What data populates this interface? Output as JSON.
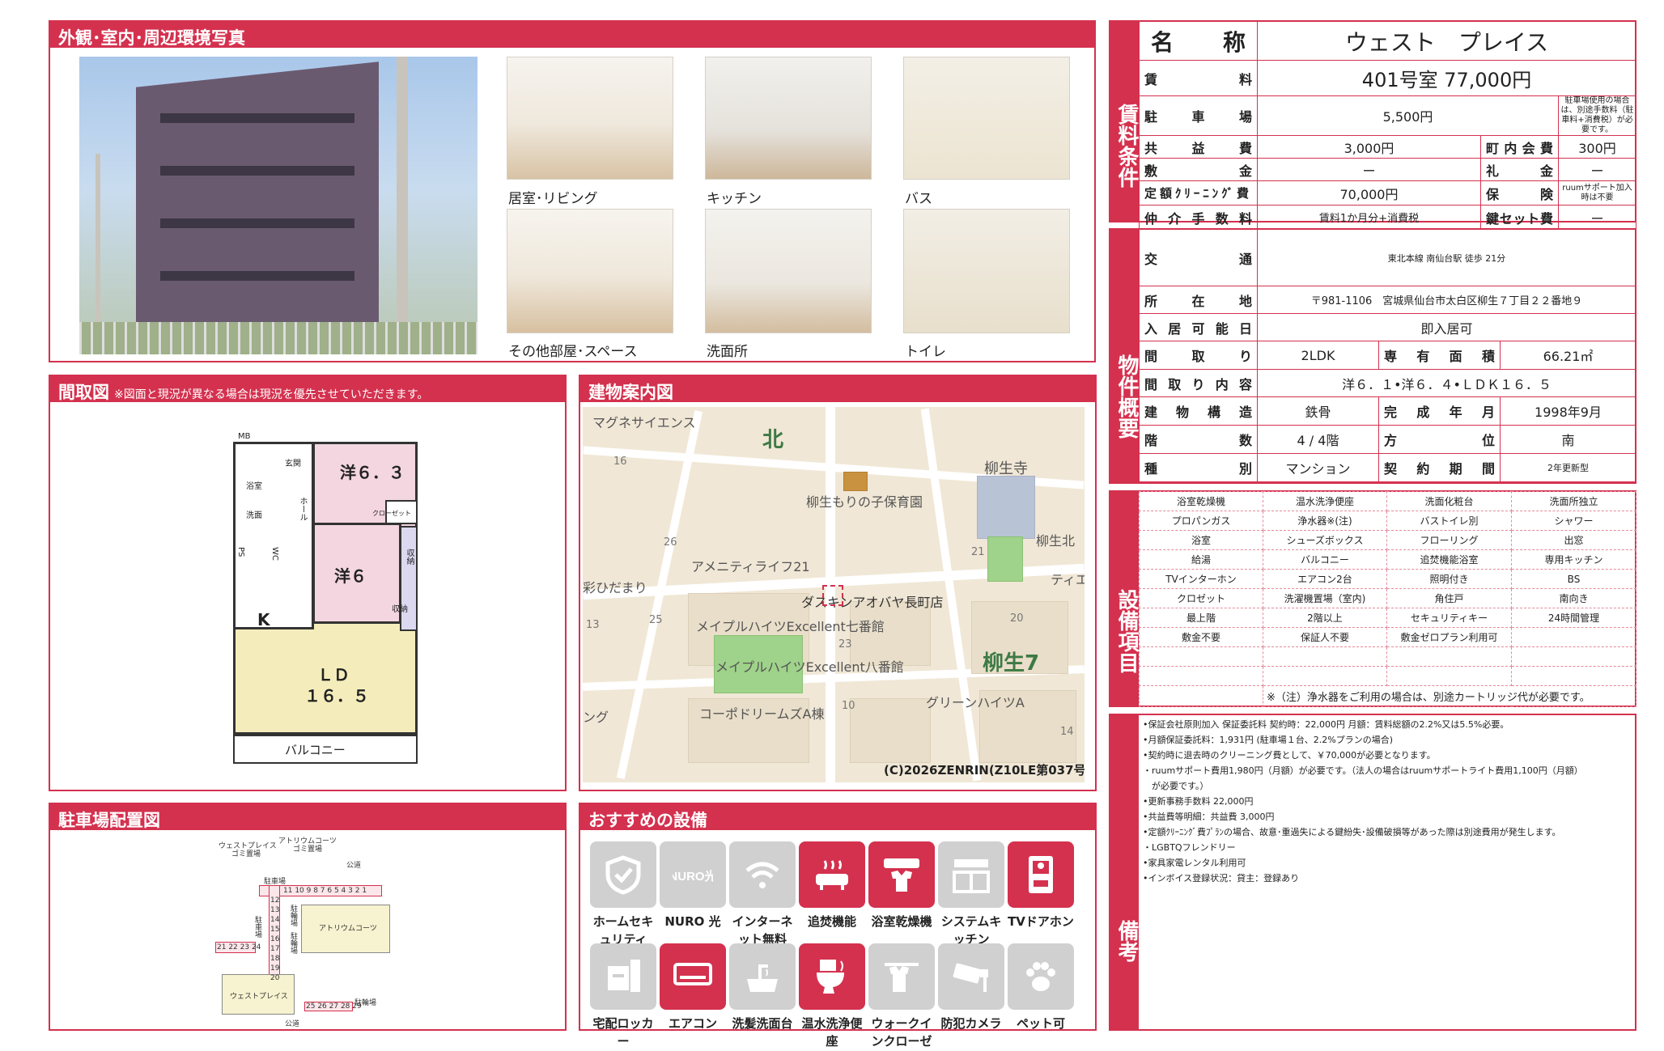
{
  "photos_section": {
    "title": "外観･室内･周辺環境写真",
    "labels": [
      "居室･リビング",
      "キッチン",
      "バス",
      "その他部屋･スペース",
      "洗面所",
      "トイレ"
    ]
  },
  "floorplan": {
    "title": "間取図",
    "note": "※図面と現況が異なる場合は現況を優先させていただきます。",
    "rooms": {
      "yo63": "洋６．３",
      "yo6": "洋６",
      "ld": "ＬＤ",
      "ld_size": "１６．５",
      "k": "K",
      "balcony": "バルコニー",
      "mb": "MB",
      "genkan": "玄関",
      "yokushitsu": "浴室",
      "senmen": "洗面",
      "hall": "ホール",
      "closet": "クローゼット",
      "shuno": "収納",
      "shuno2": "収納",
      "ps": "PS",
      "wc": "WC"
    }
  },
  "map": {
    "title": "建物案内図",
    "labels": {
      "north": "北",
      "magune": "マグネサイエンス",
      "hoikuen": "柳生もりの子保育園",
      "temple": "柳生寺",
      "amenity": "アメニティライフ21",
      "hidamari": "彩ひだまり",
      "daskin": "ダスキンアオバヤ長町店",
      "maple7": "メイプルハイツExcellent七番館",
      "maple8": "メイプルハイツExcellent八番館",
      "yagyu7": "柳生7",
      "corpo": "コーポドリームズA棟",
      "green": "グリーンハイツA",
      "yagyukita": "柳生北",
      "tei": "ティエ",
      "kuku": "ング"
    },
    "numbers": [
      "16",
      "26",
      "21",
      "13",
      "25",
      "23",
      "20",
      "10",
      "14"
    ],
    "copyright": "(C)2026ZENRIN(Z10LE第037号)"
  },
  "parking": {
    "title": "駐車場配置図",
    "labels": {
      "west": "ウェストプレイス",
      "gomi": "ゴミ置場",
      "atrium": "アトリウムコーツ",
      "gomi2": "ゴミ置場",
      "road_top": "公道",
      "road_bottom": "公道",
      "chusha": "駐車場",
      "chusha2": "駐車場",
      "chusha3": "駐輪場",
      "chusha4": "駐輪場",
      "atrium_bldg": "アトリウムコーツ",
      "west_bldg": "ウェストプレイス",
      "bike": "駐輪場"
    },
    "top_row": "11 10 9 8 7 6 5 4 3 2 1",
    "col": [
      "12",
      "13",
      "14",
      "15",
      "16",
      "17",
      "18",
      "19",
      "20"
    ],
    "left_row": "21 22 23 24",
    "bottom_row": "25 26 27 28 29"
  },
  "amenities": {
    "title": "おすすめの設備",
    "items": [
      {
        "label": "ホームセキュリティ",
        "icon": "shield-icon",
        "on": false
      },
      {
        "label": "NURO 光",
        "icon": "nuro-icon",
        "on": false
      },
      {
        "label": "インターネット無料",
        "icon": "wifi-icon",
        "on": false
      },
      {
        "label": "追焚機能",
        "icon": "bathtub-icon",
        "on": true
      },
      {
        "label": "浴室乾燥機",
        "icon": "dryer-icon",
        "on": true
      },
      {
        "label": "システムキッチン",
        "icon": "kitchen-icon",
        "on": false
      },
      {
        "label": "TVドアホン",
        "icon": "intercom-icon",
        "on": true
      },
      {
        "label": "宅配ロッカー",
        "icon": "locker-icon",
        "on": false
      },
      {
        "label": "エアコン",
        "icon": "aircon-icon",
        "on": true
      },
      {
        "label": "洗髪洗面台",
        "icon": "sink-icon",
        "on": false
      },
      {
        "label": "温水洗浄便座",
        "icon": "toilet-icon",
        "on": true
      },
      {
        "label": "ウォークインクローゼット",
        "icon": "closet-icon",
        "on": false
      },
      {
        "label": "防犯カメラ",
        "icon": "camera-icon",
        "on": false
      },
      {
        "label": "ペット可",
        "icon": "paw-icon",
        "on": false
      }
    ]
  },
  "rent": {
    "tab": "賃料条件",
    "name_label": "名称",
    "name": "ウェスト　プレイス",
    "rent_label": "賃料",
    "rent": "401号室 77,000円",
    "parking_label": "駐車場",
    "parking": "5,500円",
    "parking_note": "駐車場使用の場合は、別途手数料（駐車料+消費税）が必要です。",
    "common_label": "共益費",
    "common": "3,000円",
    "town_label": "町内会費",
    "town": "300円",
    "deposit_label": "敷金",
    "deposit": "ー",
    "key_money_label": "礼金",
    "key_money": "ー",
    "cleaning_label": "定額ｸﾘｰﾆﾝｸﾞ費",
    "cleaning": "70,000円",
    "insurance_label": "保険",
    "insurance": "ruumサポート加入時は不要",
    "broker_label": "仲介手数料",
    "broker": "賃料1か月分+消費税",
    "keyset_label": "鍵セット費",
    "keyset": "ー"
  },
  "property": {
    "tab": "物件概要",
    "access_label": "交通",
    "access": "東北本線 南仙台駅 徒歩 21分",
    "address_label": "所在地",
    "address": "〒981-1106　宮城県仙台市太白区柳生７丁目２２番地９",
    "movein_label": "入居可能日",
    "movein": "即入居可",
    "layout_label": "間取り",
    "layout": "2LDK",
    "area_label": "専有面積",
    "area": "66.21㎡",
    "detail_label": "間取り内容",
    "detail": "洋６．１•洋６．４•ＬＤＫ１６．５",
    "structure_label": "建物構造",
    "structure": "鉄骨",
    "built_label": "完成年月",
    "built": "1998年9月",
    "floor_label": "階数",
    "floor": "4 / 4階",
    "direction_label": "方位",
    "direction": "南",
    "type_label": "種別",
    "type": "マンション",
    "contract_label": "契約期間",
    "contract": "2年更新型"
  },
  "equipment": {
    "tab": "設備項目",
    "rows": [
      [
        "浴室乾燥機",
        "温水洗浄便座",
        "洗面化粧台",
        "洗面所独立"
      ],
      [
        "プロパンガス",
        "浄水器※(注)",
        "バストイレ別",
        "シャワー"
      ],
      [
        "浴室",
        "シューズボックス",
        "フローリング",
        "出窓"
      ],
      [
        "給湯",
        "バルコニー",
        "追焚機能浴室",
        "専用キッチン"
      ],
      [
        "TVインターホン",
        "エアコン2台",
        "照明付き",
        "BS"
      ],
      [
        "クロゼット",
        "洗濯機置場（室内)",
        "角住戸",
        "南向き"
      ],
      [
        "最上階",
        "2階以上",
        "セキュリティキー",
        "24時間管理"
      ],
      [
        "敷金不要",
        "保証人不要",
        "敷金ゼロプラン利用可",
        ""
      ],
      [
        "",
        "",
        "",
        ""
      ],
      [
        "",
        "",
        "",
        ""
      ]
    ],
    "footnote": "※（注）浄水器をご利用の場合は、別途カートリッジ代が必要です。"
  },
  "remarks": {
    "tab": "備考",
    "lines": [
      "•保証会社原則加入 保証委託料 契約時：22,000円 月額：賃料総額の2.2%又は5.5%必要。",
      "•月額保証委託料：1,931円 (駐車場１台、2.2%プランの場合)",
      "•契約時に退去時のクリーニング費として、￥70,000が必要となります。",
      "・ruumサポート費用1,980円（月額）が必要です。（法人の場合はruumサポートライト費用1,100円（月額）",
      "　が必要です。）",
      "•更新事務手数料 22,000円",
      "•共益費等明細：共益費 3,000円",
      "•定額ｸﾘｰﾆﾝｸﾞ費ﾌﾟﾗﾝの場合、故意･重過失による鍵紛失･設備破損等があった際は別途費用が発生します。",
      "・LGBTQフレンドリー",
      "•家具家電レンタル利用可",
      "•インボイス登録状況：貸主：登録あり"
    ]
  },
  "colors": {
    "accent": "#d4314f",
    "icon_off": "#d0d0d0"
  }
}
